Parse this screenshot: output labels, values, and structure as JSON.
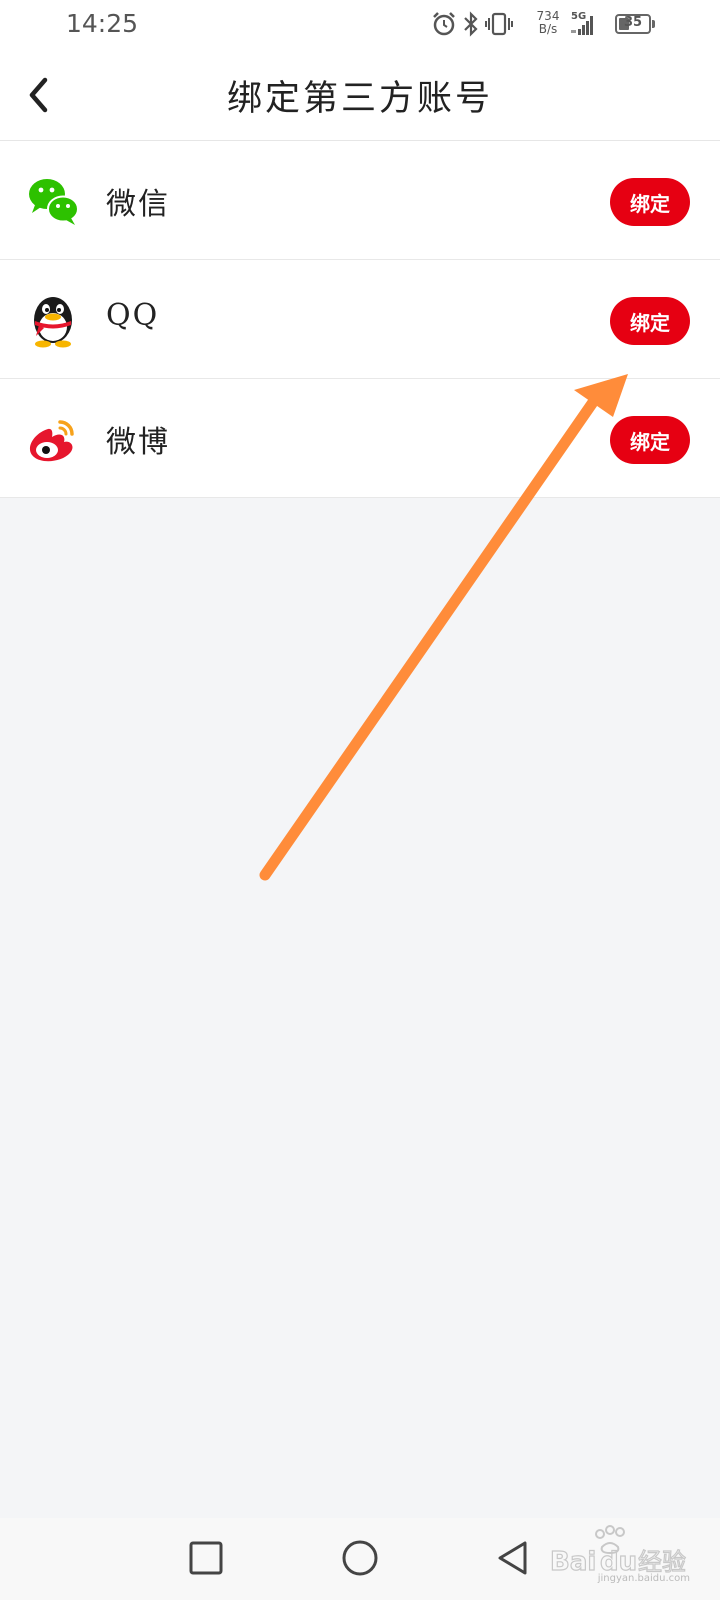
{
  "status_bar": {
    "time": "14:25",
    "net_speed_value": "734",
    "net_speed_unit": "B/s",
    "net_type": "5G",
    "battery_level": "35",
    "icons": [
      "alarm-icon",
      "bluetooth-icon",
      "vibrate-icon",
      "signal-icon",
      "battery-icon"
    ]
  },
  "header": {
    "title": "绑定第三方账号",
    "back_icon": "chevron-left-icon"
  },
  "accounts": [
    {
      "name": "微信",
      "icon": "wechat-icon",
      "button_label": "绑定",
      "icon_color": "#2dc100"
    },
    {
      "name": "QQ",
      "icon": "qq-penguin-icon",
      "button_label": "绑定",
      "icon_color": "#000000"
    },
    {
      "name": "微博",
      "icon": "weibo-icon",
      "button_label": "绑定",
      "icon_color": "#e6162d"
    }
  ],
  "colors": {
    "accent": "#e60012",
    "annotation_arrow": "#ff8c3a",
    "background": "#f4f5f7"
  },
  "nav_bar": {
    "icons": [
      "recents-square-icon",
      "home-circle-icon",
      "back-triangle-icon"
    ]
  },
  "watermark": {
    "text": "jingyan.baidu.com"
  }
}
